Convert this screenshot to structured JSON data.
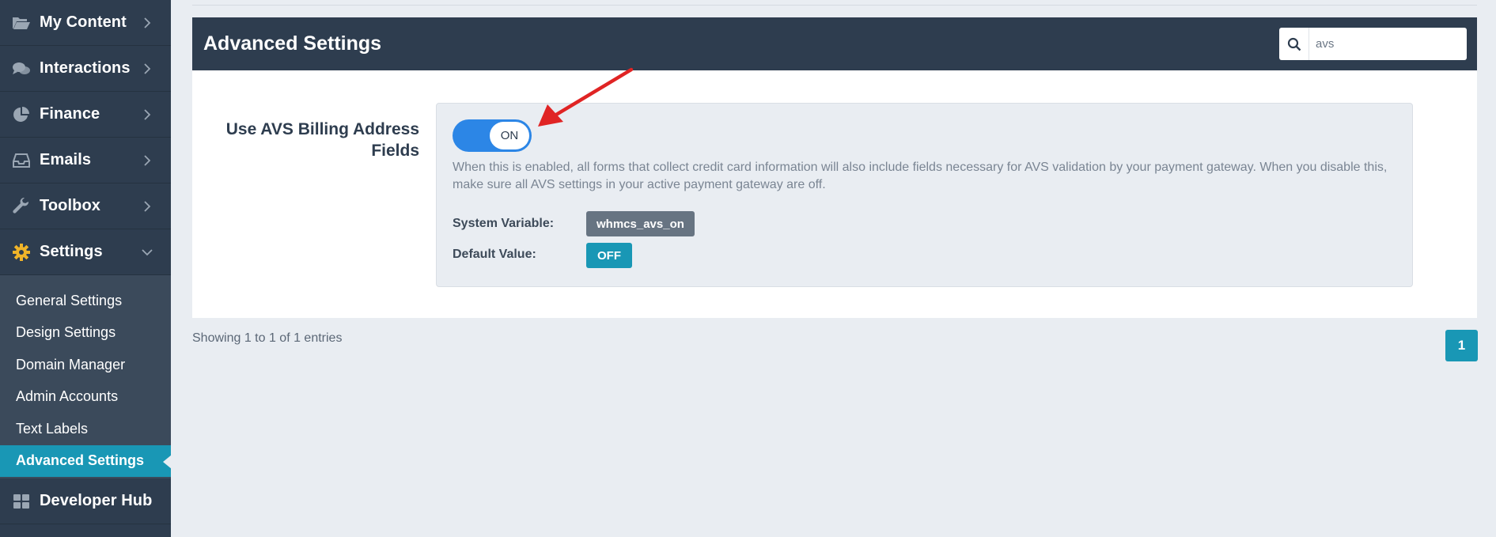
{
  "sidebar": {
    "items": [
      {
        "label": "My Content",
        "icon": "folder-open-icon"
      },
      {
        "label": "Interactions",
        "icon": "comments-icon"
      },
      {
        "label": "Finance",
        "icon": "pie-chart-icon"
      },
      {
        "label": "Emails",
        "icon": "inbox-icon"
      },
      {
        "label": "Toolbox",
        "icon": "wrench-icon"
      },
      {
        "label": "Settings",
        "icon": "gear-icon"
      }
    ],
    "settings_submenu": [
      {
        "label": "General Settings"
      },
      {
        "label": "Design Settings"
      },
      {
        "label": "Domain Manager"
      },
      {
        "label": "Admin Accounts"
      },
      {
        "label": "Text Labels"
      },
      {
        "label": "Advanced Settings"
      }
    ],
    "bottom_item": {
      "label": "Developer Hub",
      "icon": "grid-icon"
    },
    "accent_color": "#f0b429"
  },
  "panel": {
    "title": "Advanced Settings",
    "search": {
      "value": "avs"
    }
  },
  "setting": {
    "label_line1": "Use AVS Billing Address",
    "label_line2": "Fields",
    "toggle_state": "ON",
    "description": "When this is enabled, all forms that collect credit card information will also include fields necessary for AVS validation by your payment gateway. When you disable this, make sure all AVS settings in your active payment gateway are off.",
    "system_variable_label": "System Variable:",
    "system_variable_value": "whmcs_avs_on",
    "default_value_label": "Default Value:",
    "default_value": "OFF"
  },
  "footer": {
    "entries_text": "Showing 1 to 1 of 1 entries",
    "current_page": "1"
  },
  "colors": {
    "sidebar_bg": "#2e3d4f",
    "accent": "#1997b5",
    "toggle_on": "#2c86e6",
    "annotation_arrow": "#e02424"
  }
}
